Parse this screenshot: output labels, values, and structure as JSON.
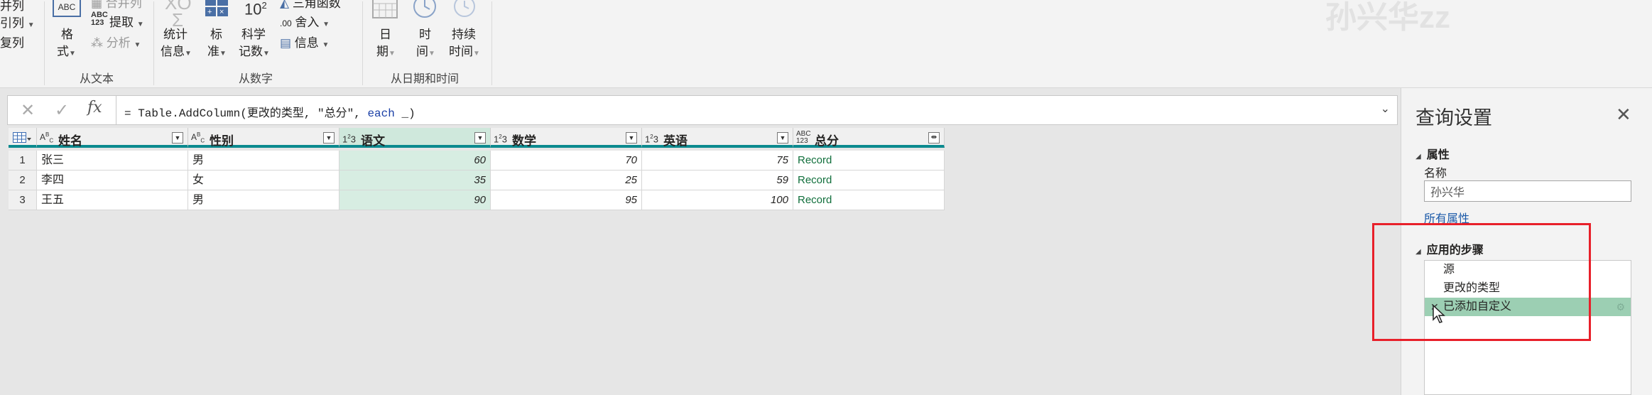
{
  "ribbon": {
    "left_items": [
      "并列",
      "引列",
      "复列"
    ],
    "format": {
      "line1": "格",
      "line2": "式"
    },
    "extract": {
      "icon_text": "ABC\n123",
      "label": "提取"
    },
    "merge_cols": {
      "label": "合并列"
    },
    "analyze": {
      "label": "分析"
    },
    "group_text": "从文本",
    "stats": {
      "line1": "统计",
      "line2": "信息"
    },
    "standard": {
      "line1": "标",
      "line2": "准"
    },
    "scientific": {
      "icon": "10",
      "exp": "2",
      "line1": "科学",
      "line2": "记数"
    },
    "trig": {
      "label": "三角函数"
    },
    "rounding": {
      "label": "舍入"
    },
    "info": {
      "label": "信息"
    },
    "group_number": "从数字",
    "date": {
      "line1": "日",
      "line2": "期"
    },
    "time": {
      "line1": "时",
      "line2": "间"
    },
    "duration": {
      "line1": "持续",
      "line2": "时间"
    },
    "group_datetime": "从日期和时间",
    "watermark": "孙兴华zz"
  },
  "formula_bar": {
    "cancel": "✕",
    "commit": "✓",
    "fx": "fx",
    "prefix": "= Table.AddColumn(更改的类型, \"总分\", ",
    "keyword": "each",
    "suffix": " _)"
  },
  "grid": {
    "columns": [
      {
        "type": "ABC",
        "name": "姓名"
      },
      {
        "type": "ABC",
        "name": "性别"
      },
      {
        "type": "123",
        "name": "语文"
      },
      {
        "type": "123",
        "name": "数学"
      },
      {
        "type": "123",
        "name": "英语"
      },
      {
        "type": "ABC123",
        "name": "总分"
      }
    ],
    "rows": [
      {
        "n": "1",
        "name": "张三",
        "gender": "男",
        "chinese": "60",
        "math": "70",
        "english": "75",
        "total": "Record"
      },
      {
        "n": "2",
        "name": "李四",
        "gender": "女",
        "chinese": "35",
        "math": "25",
        "english": "59",
        "total": "Record"
      },
      {
        "n": "3",
        "name": "王五",
        "gender": "男",
        "chinese": "90",
        "math": "95",
        "english": "100",
        "total": "Record"
      }
    ]
  },
  "query_settings": {
    "title": "查询设置",
    "close": "✕",
    "properties": "属性",
    "name_label": "名称",
    "name_value": "孙兴华",
    "all_properties": "所有属性",
    "applied_steps": "应用的步骤",
    "steps": [
      "源",
      "更改的类型",
      "已添加自定义"
    ]
  },
  "colors": {
    "accent_teal": "#0b8a8f",
    "selected_step": "#9ccfb3",
    "annotation_red": "#e8202a"
  }
}
